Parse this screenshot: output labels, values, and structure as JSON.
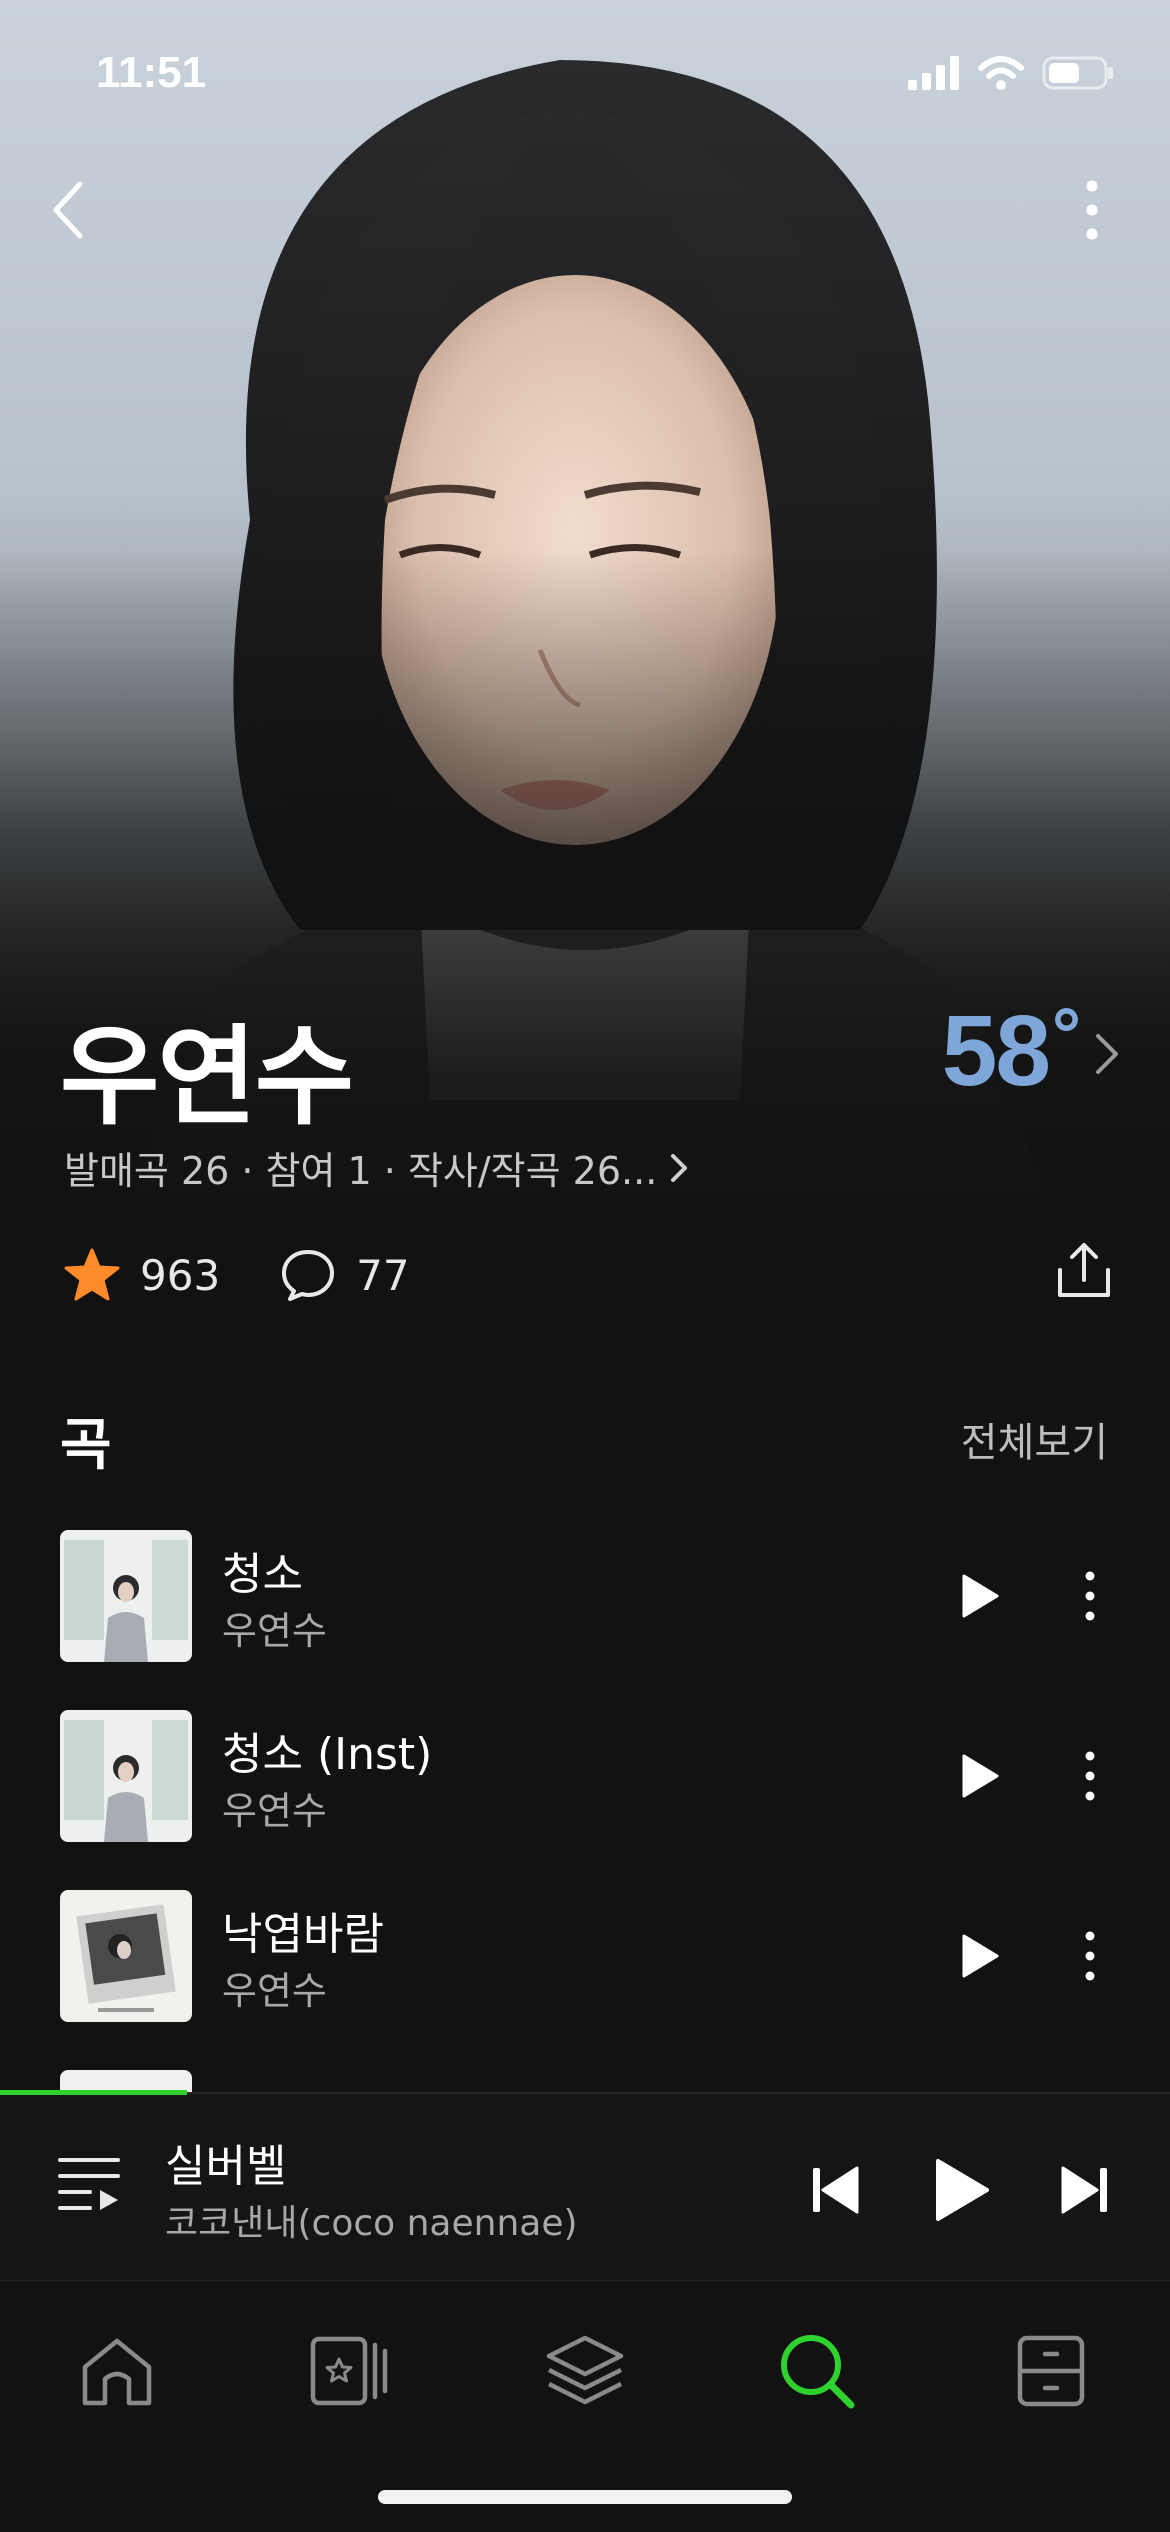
{
  "status_bar": {
    "time": "11:51"
  },
  "artist": {
    "name": "우연수",
    "temperature": "58",
    "degree_symbol": "°"
  },
  "meta": {
    "text": "발매곡 26 · 참여 1 · 작사/작곡 26..."
  },
  "stats": {
    "likes": "963",
    "comments": "77"
  },
  "songs_section": {
    "title": "곡",
    "view_all": "전체보기"
  },
  "songs": [
    {
      "title": "청소",
      "artist": "우연수"
    },
    {
      "title": "청소 (Inst)",
      "artist": "우연수"
    },
    {
      "title": "낙엽바람",
      "artist": "우연수"
    }
  ],
  "mini_player": {
    "title": "실버벨",
    "artist": "코코낸내(coco naennae)",
    "progress": 0.16
  },
  "tabs": [
    {
      "name": "home",
      "icon": "home-icon",
      "active": false
    },
    {
      "name": "library",
      "icon": "star-card-icon",
      "active": false
    },
    {
      "name": "playlist",
      "icon": "layers-icon",
      "active": false
    },
    {
      "name": "search",
      "icon": "search-icon",
      "active": true
    },
    {
      "name": "storage",
      "icon": "drawer-icon",
      "active": false
    }
  ],
  "colors": {
    "accent": "#2ed12e",
    "temperature": "#7ea6d8",
    "star": "#ff8a2a"
  }
}
